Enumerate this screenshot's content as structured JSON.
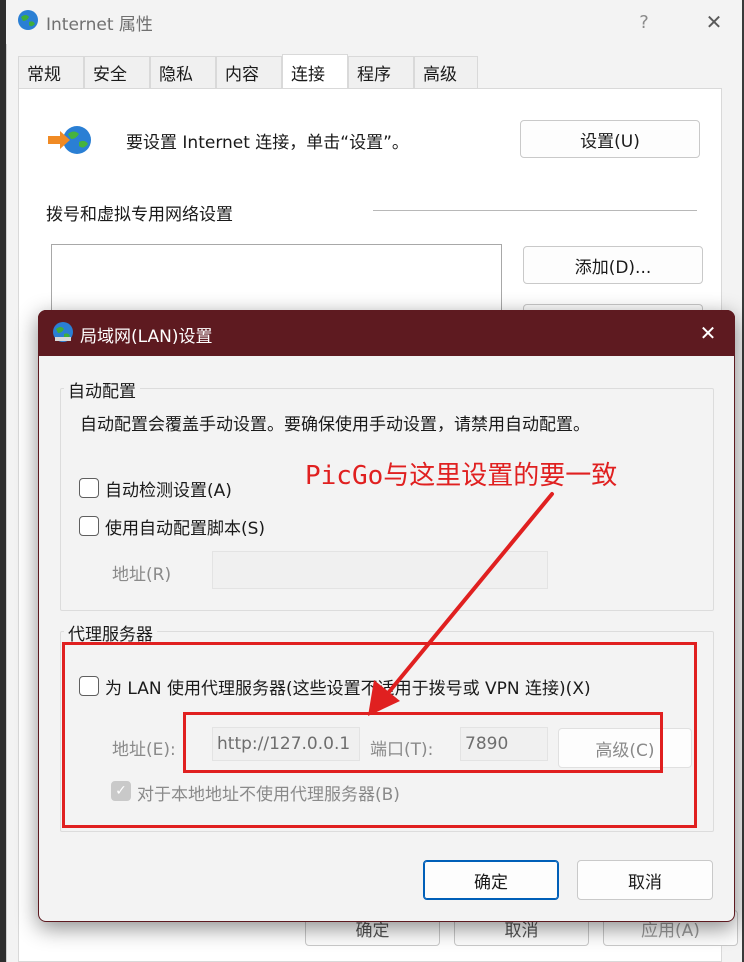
{
  "parent": {
    "title": "Internet 属性",
    "help_glyph": "?",
    "close_glyph": "✕",
    "tabs": [
      {
        "label": "常规"
      },
      {
        "label": "安全"
      },
      {
        "label": "隐私"
      },
      {
        "label": "内容"
      },
      {
        "label": "连接"
      },
      {
        "label": "程序"
      },
      {
        "label": "高级"
      }
    ],
    "setup_text": "要设置 Internet 连接，单击“设置”。",
    "setup_button": "设置(U)",
    "dialup_heading": "拨号和虚拟专用网络设置",
    "add_button": "添加(D)...",
    "bottom_buttons": {
      "ok": "确定",
      "cancel": "取消",
      "apply": "应用(A)"
    }
  },
  "dialog": {
    "title": "局域网(LAN)设置",
    "close_glyph": "✕",
    "auto_config": {
      "title": "自动配置",
      "description": "自动配置会覆盖手动设置。要确保使用手动设置，请禁用自动配置。",
      "detect_label": "自动检测设置(A)",
      "script_label": "使用自动配置脚本(S)",
      "address_label": "地址(R)"
    },
    "proxy": {
      "title": "代理服务器",
      "use_proxy_label": "为 LAN 使用代理服务器(这些设置不适用于拨号或 VPN 连接)(X)",
      "address_label": "地址(E):",
      "address_value": "http://127.0.0.1",
      "port_label": "端口(T):",
      "port_value": "7890",
      "advanced_button": "高级(C)",
      "bypass_label": "对于本地地址不使用代理服务器(B)",
      "check_glyph": "✓"
    },
    "ok": "确定",
    "cancel": "取消"
  },
  "annotation": {
    "text": "PicGo与这里设置的要一致",
    "color": "#e02020"
  },
  "colors": {
    "dialog_titlebar": "#5e1a20",
    "annotation": "#e02020",
    "accent": "#005fb8"
  }
}
